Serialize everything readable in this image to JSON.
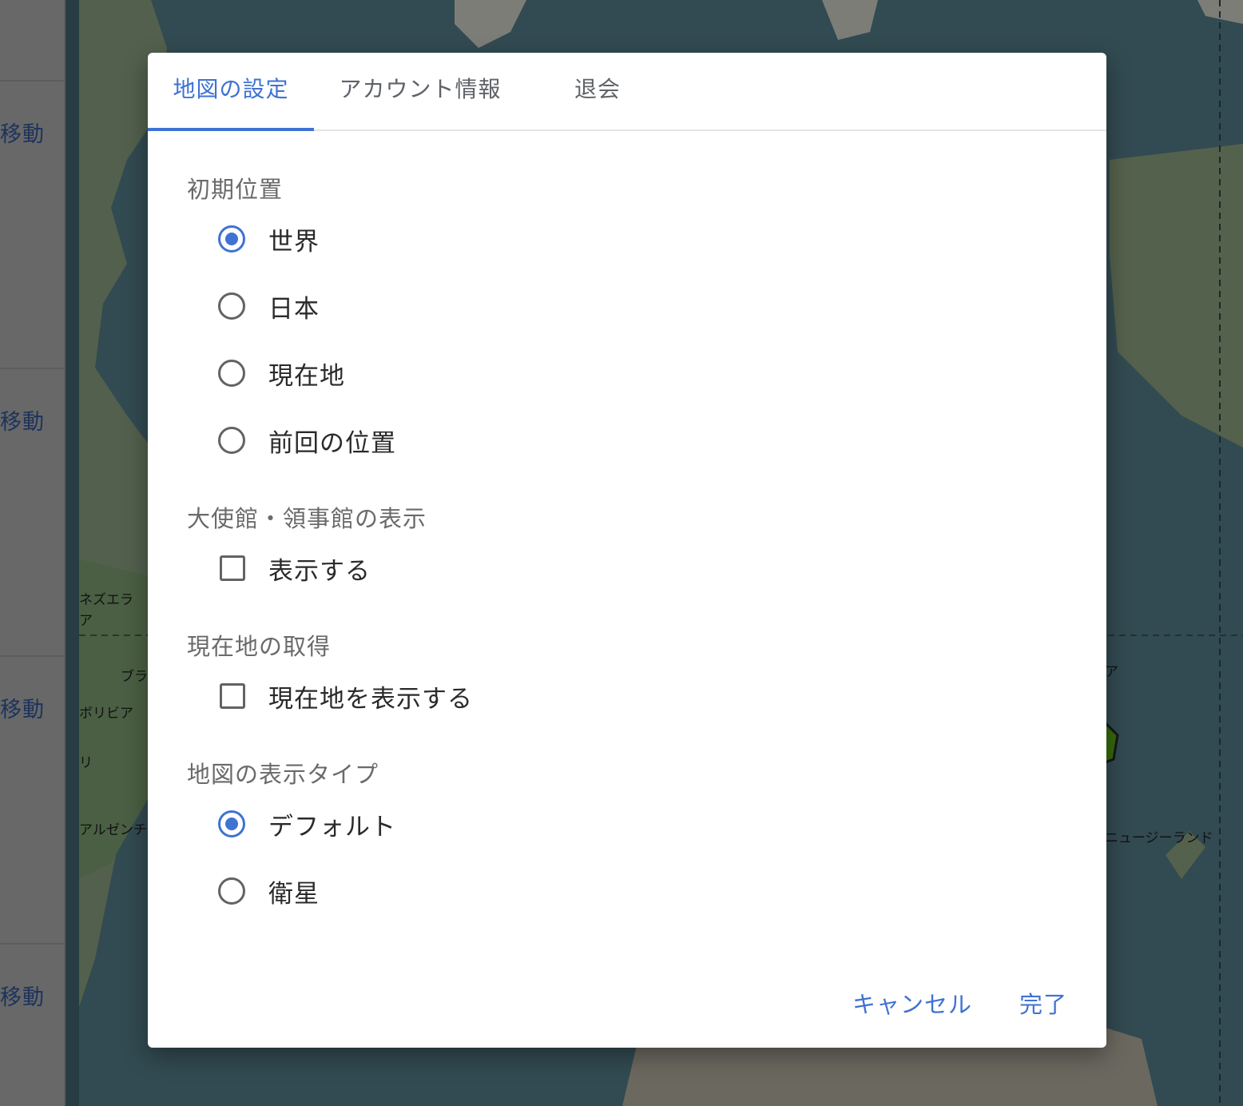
{
  "background": {
    "left_panel": {
      "move_label": "移動",
      "rows": 4
    },
    "map_labels": {
      "venezuela": "ネズエラ",
      "colombia_fragment": "ア",
      "brazil": "ブラ",
      "bolivia": "ボリビア",
      "chile": "リ",
      "argentina": "アルゼンチ",
      "newzealand": "ニュージーランド",
      "png_fragment": "ア"
    }
  },
  "dialog": {
    "tabs": [
      {
        "label": "地図の設定",
        "active": true
      },
      {
        "label": "アカウント情報",
        "active": false
      },
      {
        "label": "退会",
        "active": false
      }
    ],
    "sections": {
      "initial_position": {
        "label": "初期位置",
        "options": [
          {
            "label": "世界",
            "selected": true
          },
          {
            "label": "日本",
            "selected": false
          },
          {
            "label": "現在地",
            "selected": false
          },
          {
            "label": "前回の位置",
            "selected": false
          }
        ]
      },
      "embassy": {
        "label": "大使館・領事館の表示",
        "checkbox_label": "表示する",
        "checked": false
      },
      "current_location": {
        "label": "現在地の取得",
        "checkbox_label": "現在地を表示する",
        "checked": false
      },
      "map_type": {
        "label": "地図の表示タイプ",
        "options": [
          {
            "label": "デフォルト",
            "selected": true
          },
          {
            "label": "衛星",
            "selected": false
          }
        ]
      }
    },
    "footer": {
      "cancel_label": "キャンセル",
      "done_label": "完了"
    }
  },
  "colors": {
    "accent": "#3f72d2",
    "ocean": "#3b5a63",
    "land": "#6f8a6a"
  }
}
